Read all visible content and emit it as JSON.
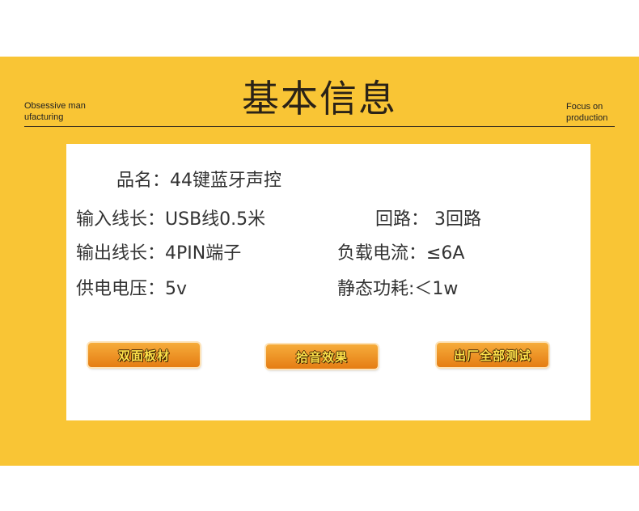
{
  "header": {
    "title": "基本信息",
    "left_tagline": "Obsessive man ufacturing",
    "right_tagline": "Focus on production"
  },
  "specs": {
    "product_name": "品名：44键蓝牙声控",
    "input_cable": "输入线长：USB线0.5米",
    "circuits": "回路：  3回路",
    "output_cable": "输出线长：4PIN端子",
    "load_current": "负载电流：≤6A",
    "supply_voltage": "供电电压：5v",
    "static_power": "静态功耗:＜1w"
  },
  "buttons": {
    "double_sided": "双面板材",
    "pickup_effect": "拾音效果",
    "factory_test": "出厂全部测试"
  },
  "colors": {
    "band": "#F9C535",
    "button": "#EE8D21",
    "button_text": "#FFE24A"
  }
}
